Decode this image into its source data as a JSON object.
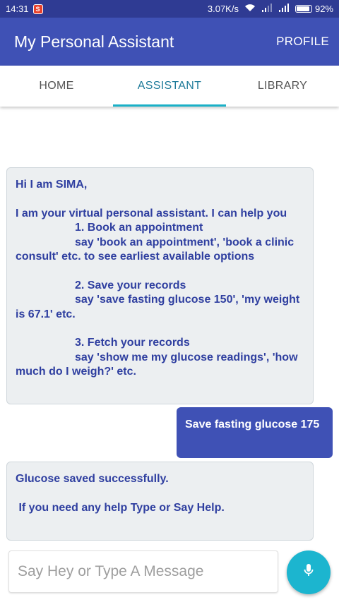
{
  "status_bar": {
    "time": "14:31",
    "app_icon_label": "S",
    "network_speed": "3.07K/s",
    "battery": "92%",
    "battery_level": 0.92
  },
  "app_bar": {
    "title": "My Personal Assistant",
    "profile_label": "PROFILE"
  },
  "tabs": [
    {
      "label": "HOME",
      "active": false
    },
    {
      "label": "ASSISTANT",
      "active": true
    },
    {
      "label": "LIBRARY",
      "active": false
    }
  ],
  "messages": {
    "welcome": {
      "greeting": "Hi I am SIMA,",
      "intro": "I am your virtual personal assistant. I can help you",
      "item1_title": "1. Book an appointment",
      "item1_line1": "say 'book an appointment', 'book a clinic",
      "item1_line2": "consult' etc. to see earliest available options",
      "item2_title": "2. Save your records",
      "item2_line1": "say 'save fasting glucose 150', 'my weight",
      "item2_line2": "is 67.1' etc.",
      "item3_title": "3. Fetch your records",
      "item3_line1": "say 'show me my glucose readings', 'how",
      "item3_line2": "much do I weigh?' etc."
    },
    "user_message": "Save fasting glucose 175",
    "reply": {
      "line1": "Glucose saved successfully.",
      "line2": " If you need any help Type or Say Help."
    }
  },
  "input": {
    "placeholder": "Say Hey or Type A Message",
    "value": ""
  },
  "colors": {
    "primary": "#3f51b5",
    "status_bar": "#2f3b93",
    "accent": "#1cb5cf",
    "bot_text": "#2f3fa0"
  }
}
